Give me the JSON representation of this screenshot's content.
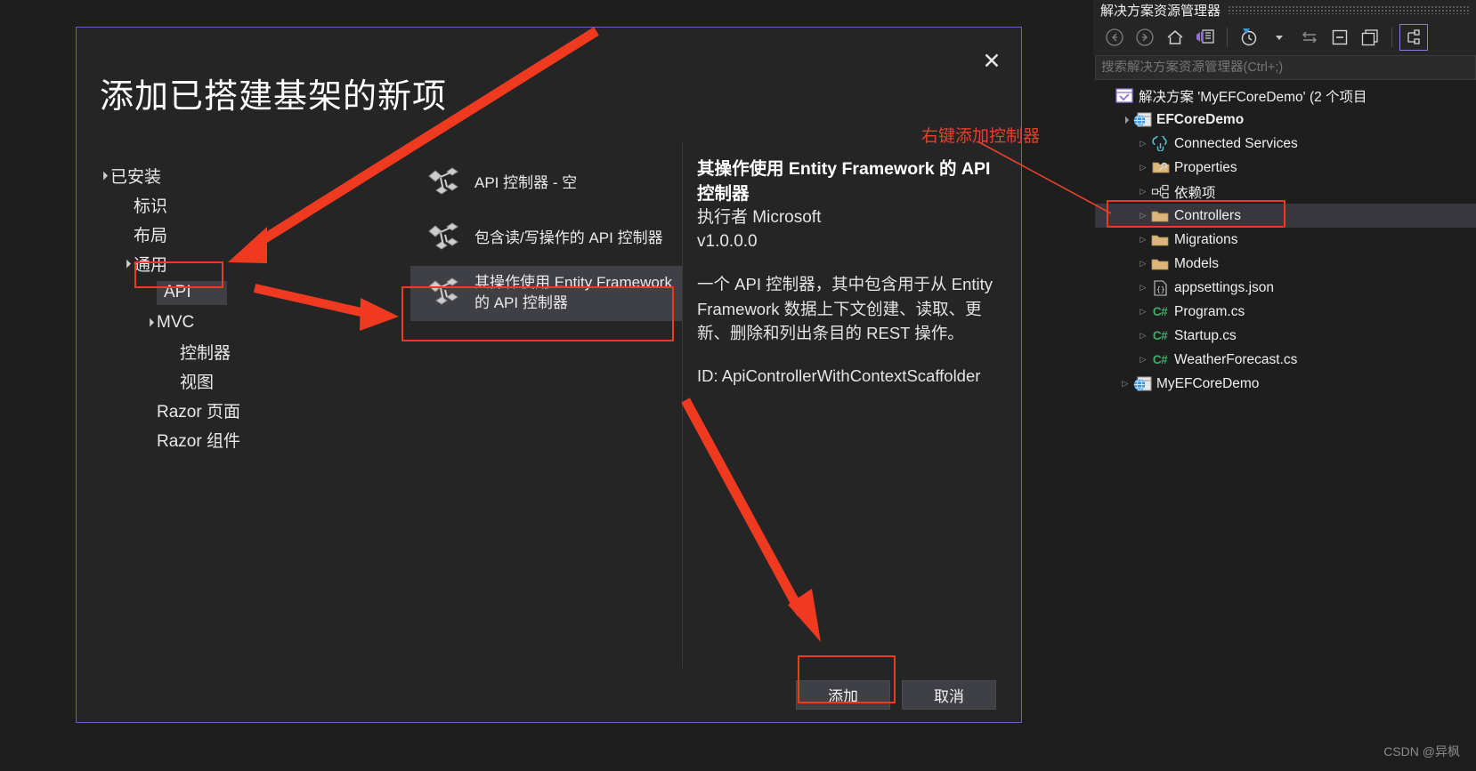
{
  "dialog": {
    "title": "添加已搭建基架的新项",
    "close_icon": "close-icon",
    "categories": [
      {
        "label": "已安装",
        "indent": 0,
        "twisty": "▲",
        "selected": false
      },
      {
        "label": "标识",
        "indent": 1,
        "twisty": "",
        "selected": false
      },
      {
        "label": "布局",
        "indent": 1,
        "twisty": "",
        "selected": false
      },
      {
        "label": "通用",
        "indent": 1,
        "twisty": "▲",
        "selected": false
      },
      {
        "label": "API",
        "indent": 2,
        "twisty": "",
        "selected": true
      },
      {
        "label": "MVC",
        "indent": 2,
        "twisty": "▲",
        "selected": false
      },
      {
        "label": "控制器",
        "indent": 3,
        "twisty": "",
        "selected": false
      },
      {
        "label": "视图",
        "indent": 3,
        "twisty": "",
        "selected": false
      },
      {
        "label": "Razor 页面",
        "indent": 2,
        "twisty": "",
        "selected": false
      },
      {
        "label": "Razor 组件",
        "indent": 2,
        "twisty": "",
        "selected": false
      }
    ],
    "templates": [
      {
        "label": "API 控制器 - 空",
        "selected": false,
        "wrap": false
      },
      {
        "label": "包含读/写操作的 API 控制器",
        "selected": false,
        "wrap": false
      },
      {
        "label": "其操作使用 Entity Framework 的 API 控制器",
        "selected": true,
        "wrap": true
      }
    ],
    "details": {
      "title": "其操作使用 Entity Framework 的 API 控制器",
      "author": "执行者 Microsoft",
      "version": "v1.0.0.0",
      "description": "一个 API 控制器，其中包含用于从 Entity Framework 数据上下文创建、读取、更新、删除和列出条目的 REST 操作。",
      "id": "ID: ApiControllerWithContextScaffolder"
    },
    "buttons": {
      "add": "添加",
      "cancel": "取消"
    }
  },
  "solution_explorer": {
    "title": "解决方案资源管理器",
    "toolbar": [
      {
        "name": "back-icon"
      },
      {
        "name": "forward-icon"
      },
      {
        "name": "home-icon"
      },
      {
        "name": "solution-view-icon"
      },
      {
        "name": "pending-changes-icon"
      },
      {
        "name": "chevron-down-icon"
      },
      {
        "name": "sync-with-active-document-icon"
      },
      {
        "name": "collapse-all-icon"
      },
      {
        "name": "show-all-files-icon"
      },
      {
        "name": "properties-icon"
      }
    ],
    "search_placeholder": "搜索解决方案资源管理器(Ctrl+;)",
    "tree": [
      {
        "label": "解决方案 'MyEFCoreDemo' (2 个项目",
        "indent": 0,
        "twisty": "",
        "icon": "solution-icon",
        "bold": false,
        "selected": false
      },
      {
        "label": "EFCoreDemo",
        "indent": 1,
        "twisty": "▲",
        "icon": "web-project-icon",
        "bold": true,
        "selected": false
      },
      {
        "label": "Connected Services",
        "indent": 2,
        "twisty": "▶",
        "icon": "connected-services-icon",
        "bold": false,
        "selected": false
      },
      {
        "label": "Properties",
        "indent": 2,
        "twisty": "▶",
        "icon": "properties-folder-icon",
        "bold": false,
        "selected": false
      },
      {
        "label": "依赖项",
        "indent": 2,
        "twisty": "▶",
        "icon": "dependencies-icon",
        "bold": false,
        "selected": false
      },
      {
        "label": "Controllers",
        "indent": 2,
        "twisty": "▶",
        "icon": "folder-icon",
        "bold": false,
        "selected": true
      },
      {
        "label": "Migrations",
        "indent": 2,
        "twisty": "▶",
        "icon": "folder-icon",
        "bold": false,
        "selected": false
      },
      {
        "label": "Models",
        "indent": 2,
        "twisty": "▶",
        "icon": "folder-icon",
        "bold": false,
        "selected": false
      },
      {
        "label": "appsettings.json",
        "indent": 2,
        "twisty": "▶",
        "icon": "json-file-icon",
        "bold": false,
        "selected": false
      },
      {
        "label": "Program.cs",
        "indent": 2,
        "twisty": "▶",
        "icon": "csharp-file-icon",
        "bold": false,
        "selected": false
      },
      {
        "label": "Startup.cs",
        "indent": 2,
        "twisty": "▶",
        "icon": "csharp-file-icon",
        "bold": false,
        "selected": false
      },
      {
        "label": "WeatherForecast.cs",
        "indent": 2,
        "twisty": "▶",
        "icon": "csharp-file-icon",
        "bold": false,
        "selected": false
      },
      {
        "label": "MyEFCoreDemo",
        "indent": 1,
        "twisty": "▶",
        "icon": "web-project-icon",
        "bold": false,
        "selected": false
      }
    ]
  },
  "annotations": {
    "note": "右键添加控制器",
    "color": "#e8402a"
  },
  "watermark": "CSDN @异枫"
}
